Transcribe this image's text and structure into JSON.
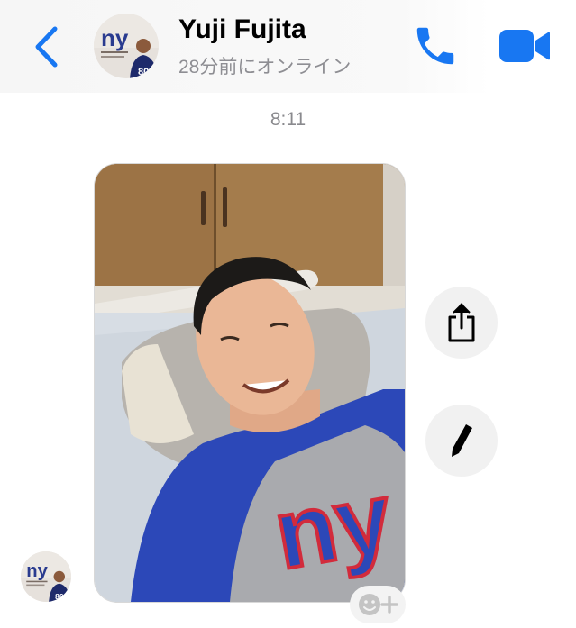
{
  "header": {
    "contact_name": "Yuji Fujita",
    "status": "28分前にオンライン",
    "avatar_logo_text": "ny",
    "back_icon": "chevron-left-icon",
    "call_icon": "phone-icon",
    "video_icon": "video-camera-icon",
    "accent_color": "#1877f2"
  },
  "conversation": {
    "timestamp": "8:11",
    "message": {
      "type": "photo",
      "shirt_logo_text": "ny"
    }
  },
  "actions": {
    "share_icon": "share-icon",
    "edit_icon": "pencil-icon",
    "reaction_icon": "add-reaction-icon"
  }
}
